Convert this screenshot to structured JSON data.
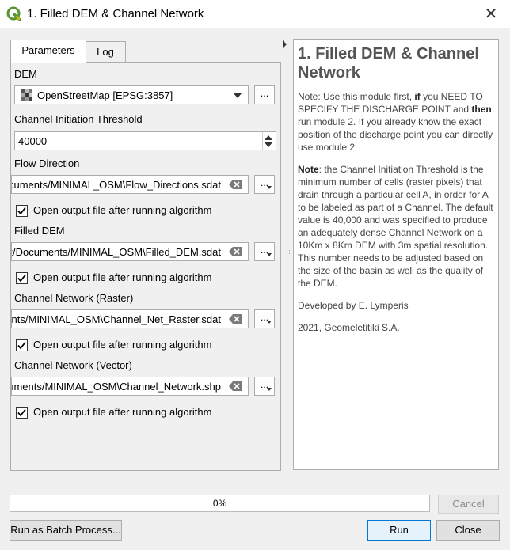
{
  "window": {
    "title": "1. Filled DEM & Channel Network",
    "close_icon": "close-icon",
    "logo_icon": "qgis-logo-icon"
  },
  "tabs": [
    {
      "label": "Parameters",
      "active": true
    },
    {
      "label": "Log",
      "active": false
    }
  ],
  "params": {
    "dem": {
      "label": "DEM",
      "value": "OpenStreetMap [EPSG:3857]",
      "browse_label": "..."
    },
    "threshold": {
      "label": "Channel Initiation Threshold",
      "value": "40000"
    },
    "flow_direction": {
      "label": "Flow Direction",
      "value": "cuments/MINIMAL_OSM\\Flow_Directions.sdat",
      "checkbox_label": "Open output file after running algorithm",
      "checked": true,
      "menu_label": "..."
    },
    "filled_dem": {
      "label": "Filled DEM",
      "value": "k/Documents/MINIMAL_OSM\\Filled_DEM.sdat",
      "checkbox_label": "Open output file after running algorithm",
      "checked": true,
      "menu_label": "..."
    },
    "channel_raster": {
      "label": "Channel Network (Raster)",
      "value": "ents/MINIMAL_OSM\\Channel_Net_Raster.sdat",
      "checkbox_label": "Open output file after running algorithm",
      "checked": true,
      "menu_label": "..."
    },
    "channel_vector": {
      "label": "Channel Network (Vector)",
      "value": "uments/MINIMAL_OSM\\Channel_Network.shp",
      "checkbox_label": "Open output file after running algorithm",
      "checked": true,
      "menu_label": "..."
    }
  },
  "help": {
    "title": "1. Filled DEM & Channel Network",
    "p1_a": "Note: Use this module first, ",
    "p1_b": "if",
    "p1_c": " you NEED TO SPECIFY THE DISCHARGE POINT and ",
    "p1_d": "then",
    "p1_e": " run module 2. If you already know the exact position of the discharge point you can directly use module 2",
    "p2_a": "Note",
    "p2_b": ": the Channel Initiation Threshold is the minimum number of cells (raster pixels) that drain through a particular cell A, in order for A to be labeled as part of a Channel. The default value is 40,000 and was specified to produce an adequately dense Channel Network on a 10Km x 8Km DEM with 3m spatial resolution. This number needs to be adjusted based on the size of the basin as well as the quality of the DEM.",
    "p3": "Developed by E. Lymperis",
    "p4": "2021, Geomeletitiki S.A."
  },
  "footer": {
    "progress_text": "0%",
    "progress_value": 0,
    "cancel_label": "Cancel",
    "batch_label": "Run as Batch Process...",
    "run_label": "Run",
    "close_label": "Close"
  },
  "colors": {
    "qgis_green": "#589632",
    "qgis_yellow": "#ee7913",
    "accent_blue": "#0078d7"
  }
}
